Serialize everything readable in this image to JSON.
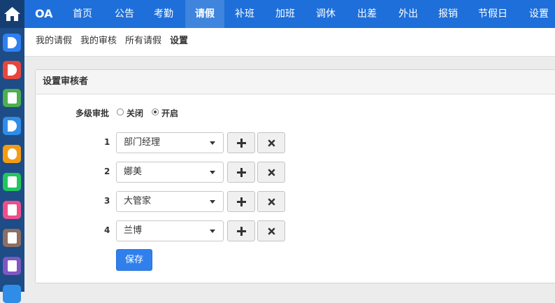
{
  "rail": {
    "apps": [
      {
        "icon": "c-app-icon",
        "color": "#2f7ff0"
      },
      {
        "icon": "half-circle-app-icon",
        "color": "#e8463c"
      },
      {
        "icon": "p-app-icon",
        "color": "#4caf50"
      },
      {
        "icon": "d-app-icon",
        "color": "#2f8de8"
      },
      {
        "icon": "s-app-icon",
        "color": "#f39c12"
      },
      {
        "icon": "t-app-icon",
        "color": "#22c55e"
      },
      {
        "icon": "h-app-icon",
        "color": "#ec4f8a"
      },
      {
        "icon": "i-app-icon",
        "color": "#8d6e63"
      },
      {
        "icon": "f-app-icon",
        "color": "#7e57c2"
      }
    ]
  },
  "topnav": {
    "brand": "OA",
    "items": [
      "首页",
      "公告",
      "考勤",
      "请假",
      "补班",
      "加班",
      "调休",
      "出差",
      "外出",
      "报销",
      "节假日",
      "设置"
    ],
    "active": "请假"
  },
  "subnav": {
    "items": [
      "我的请假",
      "我的审核",
      "所有请假",
      "设置"
    ],
    "active": "设置"
  },
  "panel": {
    "title": "设置审核者",
    "multi_label": "多级审批",
    "options": [
      "关闭",
      "开启"
    ],
    "selected_option": "开启",
    "rows": [
      {
        "num": "1",
        "value": "部门经理"
      },
      {
        "num": "2",
        "value": "娜美"
      },
      {
        "num": "3",
        "value": "大管家"
      },
      {
        "num": "4",
        "value": "兰博"
      }
    ],
    "save_label": "保存"
  },
  "colors": {
    "topnav_bg": "#1e6fd9",
    "rail_bg": "#1d4c86",
    "primary": "#2f80ed"
  }
}
